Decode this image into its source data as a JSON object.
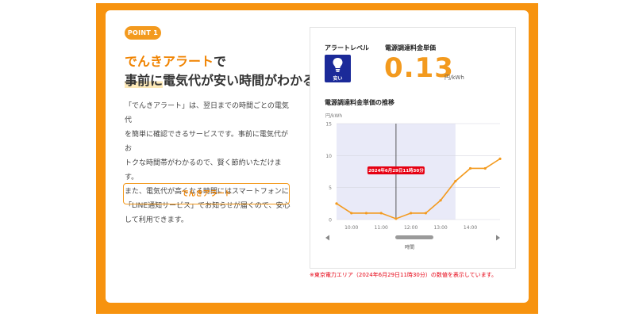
{
  "badge": "POINT 1",
  "heading": {
    "line1_highlight": "でんきアラート",
    "line1_rest": "で",
    "line2_mark": "事前に",
    "line2_rest": "電気代が安い時間がわかる！"
  },
  "body": {
    "lines": [
      "「でんきアラート」は、翌日までの時間ごとの電気代",
      "を簡単に確認できるサービスです。事前に電気代がお",
      "トクな時間帯がわかるので、賢く節約いただけます。",
      "また、電気代が高くなる時間にはスマートフォンに",
      "「LINE通知サービス」でお知らせが届くので、安心",
      "して利用できます。"
    ]
  },
  "cta_label": "でんきアラート",
  "panel": {
    "alert_level_label": "アラートレベル",
    "alert_level_text": "安い",
    "alert_icon": "lightbulb-icon",
    "price_label": "電源調達料金単価",
    "price_value": "0.13",
    "price_unit": "円/kWh",
    "trend_title": "電源調達料金単価の推移"
  },
  "chart_data": {
    "type": "line",
    "ylabel": "円/kWh",
    "xlabel": "時間",
    "ylim": [
      0,
      15
    ],
    "yticks": [
      "0",
      "5",
      "10",
      "15"
    ],
    "xticks": [
      "10:00",
      "11:00",
      "12:00",
      "13:00",
      "14:00"
    ],
    "x": [
      9.5,
      10.0,
      10.5,
      11.0,
      11.5,
      12.0,
      12.5,
      13.0,
      13.5,
      14.0,
      14.5,
      15.0
    ],
    "values": [
      2.5,
      1,
      1,
      1,
      0.13,
      1,
      1,
      3,
      6,
      8,
      8,
      9.5
    ],
    "highlight_range": [
      9.5,
      13.5
    ],
    "marker_x": 11.5,
    "tooltip": "2024年6月29日11時30分",
    "line_color": "#f39a1e"
  },
  "footnote": "※東京電力エリア（2024年6月29日11時30分）の数値を表示しています。"
}
